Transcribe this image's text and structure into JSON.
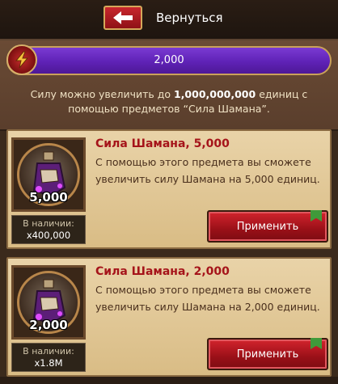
{
  "header": {
    "back_label": "Вернуться"
  },
  "power": {
    "value": "2,000"
  },
  "info": {
    "text_before": "Силу можно увеличить до ",
    "max_value": "1,000,000,000",
    "text_after": " единиц с помощью предметов “Сила Шамана”."
  },
  "items": [
    {
      "title": "Сила Шамана, 5,000",
      "description": "С помощью этого предмета вы сможете увеличить силу Шамана на 5,000 единиц.",
      "amount": "5,000",
      "stock_label": "В наличии:",
      "stock_value": "x400,000",
      "button": "Применить"
    },
    {
      "title": "Сила Шамана, 2,000",
      "description": "С помощью этого предмета вы сможете увеличить силу Шамана на 2,000 единиц.",
      "amount": "2,000",
      "stock_label": "В наличии:",
      "stock_value": "x1.8M",
      "button": "Применить"
    }
  ],
  "icons": {
    "back": "arrow-left-icon",
    "power": "lightning-icon",
    "item": "potion-bottle-icon",
    "tag": "green-bookmark-icon"
  },
  "colors": {
    "accent_red": "#c8262d",
    "bar_purple": "#6a2bc4",
    "title_red": "#a5141a"
  }
}
